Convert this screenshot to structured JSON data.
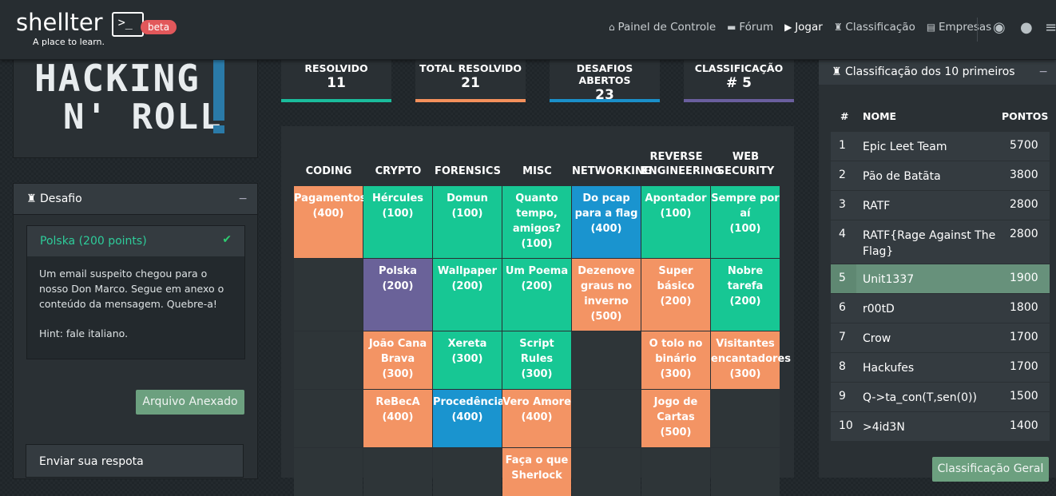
{
  "brand": {
    "name": "shellter",
    "prompt": ">_",
    "tagline": "A place to learn.",
    "badge": "beta"
  },
  "nav": [
    {
      "icon": "home-icon",
      "glyph": "⌂",
      "label": "Painel de Controle"
    },
    {
      "icon": "folder-icon",
      "glyph": "▬",
      "label": "Fórum"
    },
    {
      "icon": "play-icon",
      "glyph": "▶",
      "label": "Jogar"
    },
    {
      "icon": "trophy-icon",
      "glyph": "♜",
      "label": "Classificação"
    },
    {
      "icon": "briefcase-icon",
      "glyph": "▤",
      "label": "Empresas"
    }
  ],
  "event_logo": {
    "line1": "HACKING",
    "line2": "N' ROLL"
  },
  "challenge_panel": {
    "title": "Desafio",
    "challenge_title": "Polska (200 points)",
    "description": "Um email suspeito chegou para o nosso Don Marco. Segue em anexo o conteúdo da mensagem. Quebre-a!",
    "hint": "Hint: fale italiano.",
    "attachment_button": "Arquivo Anexado",
    "answer_title": "Enviar sua respota"
  },
  "stats": [
    {
      "label": "RESOLVIDO",
      "value": "11",
      "color": "#1abc9c"
    },
    {
      "label": "TOTAL RESOLVIDO",
      "value": "21",
      "color": "#f4905c"
    },
    {
      "label": "DESAFIOS ABERTOS",
      "value": "23",
      "color": "#1a8fc9"
    },
    {
      "label": "CLASSIFICAÇÃO",
      "value": "# 5",
      "color": "#6a5f9e"
    }
  ],
  "board": {
    "categories": [
      "CODING",
      "CRYPTO",
      "FORENSICS",
      "MISC",
      "NETWORKING",
      "REVERSE ENGINEERING",
      "WEB SECURITY"
    ],
    "colors": {
      "solved": "#17c794",
      "open": "#f39464",
      "current": "#6a6299",
      "blue": "#1a94cf",
      "empty": "#2e3538"
    },
    "rows": [
      [
        {
          "title": "Pagamentos",
          "points": "(400)",
          "state": "open"
        },
        {
          "title": "Hércules",
          "points": "(100)",
          "state": "solved"
        },
        {
          "title": "Domun",
          "points": "(100)",
          "state": "solved"
        },
        {
          "title": "Quanto tempo, amigos?",
          "points": "(100)",
          "state": "solved"
        },
        {
          "title": "Do pcap para a flag",
          "points": "(400)",
          "state": "blue"
        },
        {
          "title": "Apontador",
          "points": "(100)",
          "state": "solved"
        },
        {
          "title": "Sempre por aí",
          "points": "(100)",
          "state": "solved"
        }
      ],
      [
        {
          "title": "",
          "points": "",
          "state": "empty"
        },
        {
          "title": "Polska",
          "points": "(200)",
          "state": "current"
        },
        {
          "title": "Wallpaper",
          "points": "(200)",
          "state": "solved"
        },
        {
          "title": "Um Poema",
          "points": "(200)",
          "state": "solved"
        },
        {
          "title": "Dezenove graus no inverno",
          "points": "(500)",
          "state": "open"
        },
        {
          "title": "Super básico",
          "points": "(200)",
          "state": "open"
        },
        {
          "title": "Nobre tarefa",
          "points": "(200)",
          "state": "solved"
        }
      ],
      [
        {
          "title": "",
          "points": "",
          "state": "empty"
        },
        {
          "title": "João Cana Brava",
          "points": "(300)",
          "state": "open"
        },
        {
          "title": "Xereta",
          "points": "(300)",
          "state": "solved"
        },
        {
          "title": "Script Rules",
          "points": "(300)",
          "state": "solved"
        },
        {
          "title": "",
          "points": "",
          "state": "empty"
        },
        {
          "title": "O tolo no binário",
          "points": "(300)",
          "state": "open"
        },
        {
          "title": "Visitantes encantadores",
          "points": "(300)",
          "state": "open"
        }
      ],
      [
        {
          "title": "",
          "points": "",
          "state": "empty"
        },
        {
          "title": "ReBecA",
          "points": "(400)",
          "state": "open"
        },
        {
          "title": "Procedência",
          "points": "(400)",
          "state": "blue"
        },
        {
          "title": "Vero Amore",
          "points": "(400)",
          "state": "open"
        },
        {
          "title": "",
          "points": "",
          "state": "empty"
        },
        {
          "title": "Jogo de Cartas",
          "points": "(500)",
          "state": "open"
        },
        {
          "title": "",
          "points": "",
          "state": "empty"
        }
      ],
      [
        {
          "title": "",
          "points": "",
          "state": "empty"
        },
        {
          "title": "",
          "points": "",
          "state": "empty"
        },
        {
          "title": "",
          "points": "",
          "state": "empty"
        },
        {
          "title": "Faça o que Sherlock",
          "points": "",
          "state": "open"
        },
        {
          "title": "",
          "points": "",
          "state": "empty"
        },
        {
          "title": "",
          "points": "",
          "state": "empty"
        },
        {
          "title": "",
          "points": "",
          "state": "empty"
        }
      ]
    ]
  },
  "ranking": {
    "title": "Classificação dos 10 primeiros",
    "headers": {
      "pos": "#",
      "name": "NOME",
      "points": "PONTOS"
    },
    "rows": [
      {
        "pos": "1",
        "name": "Epic Leet Team",
        "points": "5700"
      },
      {
        "pos": "2",
        "name": "Pão de Batãta",
        "points": "3800"
      },
      {
        "pos": "3",
        "name": "RATF",
        "points": "2800"
      },
      {
        "pos": "4",
        "name": "RATF{Rage Against The Flag}",
        "points": "2800"
      },
      {
        "pos": "5",
        "name": "Unit1337",
        "points": "1900"
      },
      {
        "pos": "6",
        "name": "r00tD",
        "points": "1800"
      },
      {
        "pos": "7",
        "name": "Crow",
        "points": "1700"
      },
      {
        "pos": "8",
        "name": "Hackufes",
        "points": "1700"
      },
      {
        "pos": "9",
        "name": "Q->ta_con(T,sen(0))",
        "points": "1500"
      },
      {
        "pos": "10",
        "name": ">4id3N",
        "points": "1400"
      }
    ],
    "highlight_pos": "5",
    "button": "Classificação Geral"
  }
}
